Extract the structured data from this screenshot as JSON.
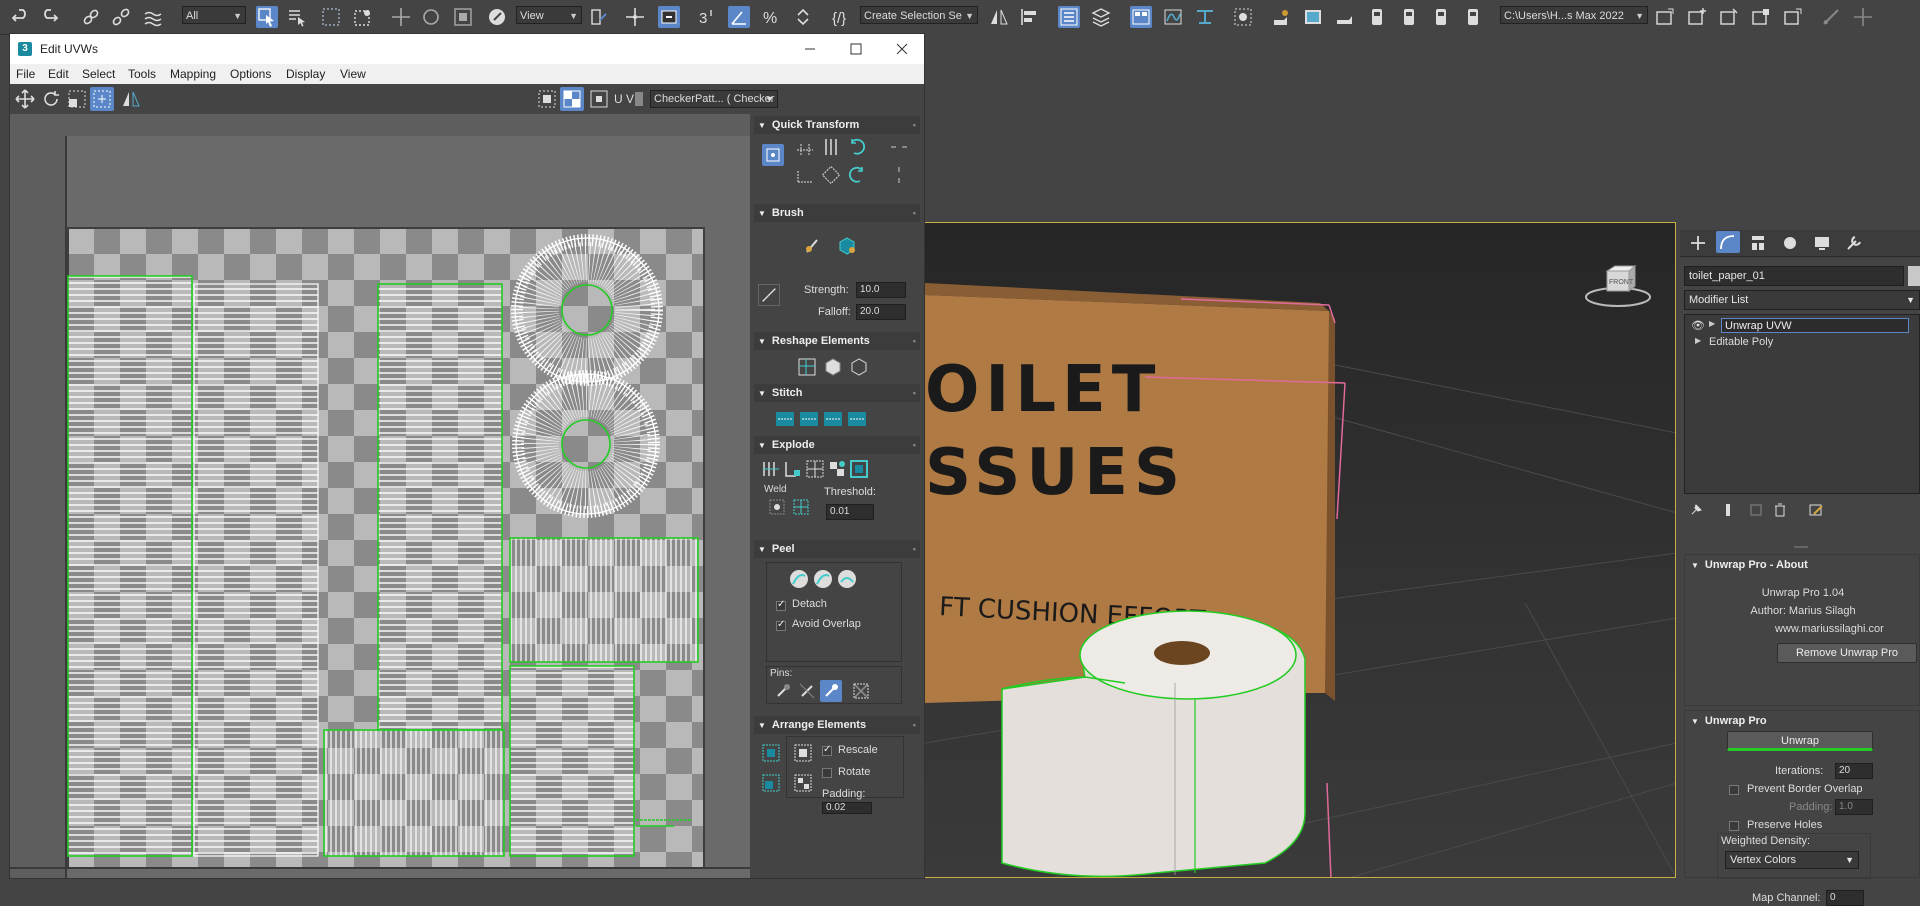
{
  "main_toolbar": {
    "selection_filter": "All",
    "reference_coord": "View",
    "named_selection": "Create Selection Se",
    "project_path": "C:\\Users\\H...s Max 2022"
  },
  "uvw_editor": {
    "title": "Edit UVWs",
    "menu": [
      "File",
      "Edit",
      "Select",
      "Tools",
      "Mapping",
      "Options",
      "Display",
      "View"
    ],
    "uv_label": "U V",
    "texture_dropdown": "CheckerPatt... ( Checker )",
    "panel": {
      "quick_transform": "Quick Transform",
      "brush": "Brush",
      "strength_label": "Strength:",
      "strength_value": "10.0",
      "falloff_label": "Falloff:",
      "falloff_value": "20.0",
      "reshape": "Reshape Elements",
      "stitch": "Stitch",
      "explode": "Explode",
      "weld_label": "Weld",
      "threshold_label": "Threshold:",
      "threshold_value": "0.01",
      "peel": "Peel",
      "detach_label": "Detach",
      "avoid_overlap_label": "Avoid Overlap",
      "pins_label": "Pins:",
      "arrange": "Arrange Elements",
      "rescale_label": "Rescale",
      "rotate_label": "Rotate",
      "padding_label": "Padding:",
      "padding_value": "0.02"
    }
  },
  "viewport": {
    "box_text_line1": "OILET",
    "box_text_line2": "SSUES",
    "box_text_line3": "FT CUSHION EFFORT",
    "viewcube_label": "FRONT"
  },
  "command_panel": {
    "object_name": "toilet_paper_01",
    "modifier_list": "Modifier List",
    "stack": [
      {
        "label": "Unwrap UVW",
        "selected": true
      },
      {
        "label": "Editable Poly",
        "selected": false
      }
    ],
    "about": {
      "title": "Unwrap Pro - About",
      "version": "Unwrap Pro 1.04",
      "author": "Author: Marius Silagh",
      "website": "www.mariussilaghi.cor",
      "remove_button": "Remove Unwrap Pro"
    },
    "unwrap_pro": {
      "title": "Unwrap Pro",
      "unwrap_button": "Unwrap",
      "iterations_label": "Iterations:",
      "iterations_value": "20",
      "prevent_border_overlap": "Prevent Border Overlap",
      "padding_label": "Padding:",
      "padding_value": "1.0",
      "preserve_holes": "Preserve Holes",
      "weighted_density_label": "Weighted Density:",
      "weighted_density_value": "Vertex Colors",
      "map_channel_label": "Map Channel:",
      "map_channel_value": "0"
    }
  },
  "colors": {
    "accent_blue": "#5b87c8",
    "uv_edge_green": "#22cc22",
    "viewport_border": "#c8b040",
    "cardboard": "#b07a45"
  }
}
